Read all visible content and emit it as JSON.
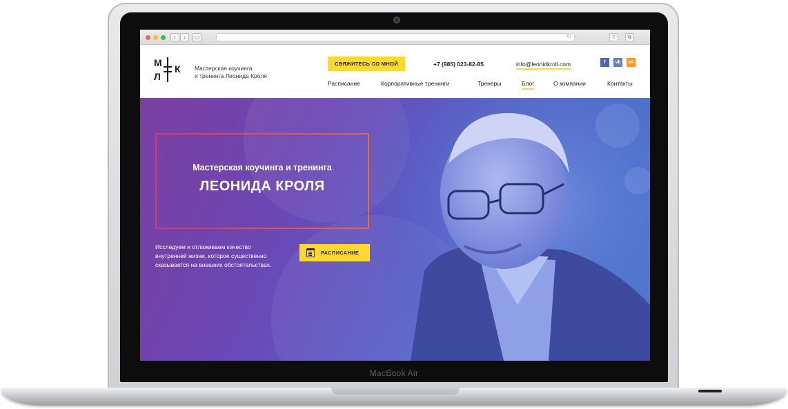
{
  "device": {
    "model_label": "MacBook Air"
  },
  "browser": {
    "back_icon": "‹",
    "forward_icon": "›",
    "reload_icon": "↻",
    "sidebar_icon": "▭",
    "share_icon": "⇪",
    "tabs_icon": "⧉"
  },
  "header": {
    "logo": {
      "letter_top": "М",
      "letter_bottom": "Л",
      "letter_right": "К"
    },
    "tagline_line1": "Мастерская коучинга",
    "tagline_line2": "и тренинга Леонида Кроля",
    "contact_button": "СВЯЖИТЕСЬ СО МНОЙ",
    "phone": "+7 (985) 023-82-85",
    "email": "info@leonidkroll.com",
    "social": [
      {
        "name": "facebook",
        "glyph": "f",
        "color": "#4a67b0"
      },
      {
        "name": "vkontakte",
        "glyph": "vk",
        "color": "#5f83b6"
      },
      {
        "name": "odnoklassniki",
        "glyph": "ok",
        "color": "#f49a2c"
      }
    ],
    "nav": [
      {
        "label": "Расписание"
      },
      {
        "label": "Корпоративные тренинги"
      },
      {
        "label": "Тренеры"
      },
      {
        "label": "Блог",
        "active": true
      },
      {
        "label": "О компании"
      },
      {
        "label": "Контакты"
      }
    ]
  },
  "hero": {
    "subtitle": "Мастерская коучинга и тренинга",
    "title": "ЛЕОНИДА КРОЛЯ",
    "text_line1": "Исследуем и отлаживаем качество",
    "text_line2": "внутренней жизни, которое существенно",
    "text_line3": "сказывается на внешних обстоятельствах.",
    "schedule_button": "РАСПИСАНИЕ",
    "accent_color": "#ffd92f"
  }
}
